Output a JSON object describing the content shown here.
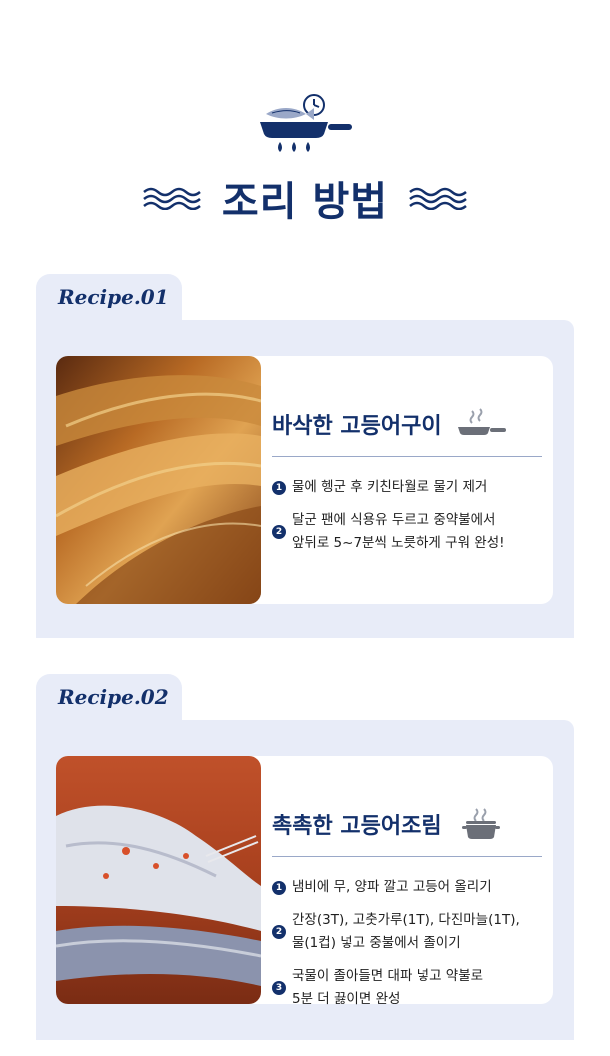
{
  "header": {
    "title": "조리 방법",
    "icon": "fish-pan-clock-icon",
    "wave_icon": "wave-icon"
  },
  "recipes": [
    {
      "tab_label": "Recipe.01",
      "title": "바삭한 고등어구이",
      "icon": "frying-pan-icon",
      "photo": "grilled-mackerel-photo",
      "steps": [
        {
          "num": "1",
          "text": "물에 헹군 후 키친타월로 물기 제거"
        },
        {
          "num": "2",
          "text": "달군 팬에 식용유 두르고 중약불에서\n앞뒤로 5~7분씩 노릇하게 구워 완성!"
        }
      ]
    },
    {
      "tab_label": "Recipe.02",
      "title": "촉촉한 고등어조림",
      "icon": "pot-icon",
      "photo": "braised-mackerel-photo",
      "steps": [
        {
          "num": "1",
          "text": "냄비에 무, 양파 깔고 고등어 올리기"
        },
        {
          "num": "2",
          "text": "간장(3T), 고춧가루(1T), 다진마늘(1T),\n물(1컵) 넣고 중불에서 졸이기"
        },
        {
          "num": "3",
          "text": "국물이 졸아들면 대파 넣고 약불로\n5분 더 끓이면 완성"
        }
      ]
    }
  ],
  "colors": {
    "navy": "#13306b",
    "panel": "#e8ecf8",
    "steam": "#2f5fb0"
  }
}
